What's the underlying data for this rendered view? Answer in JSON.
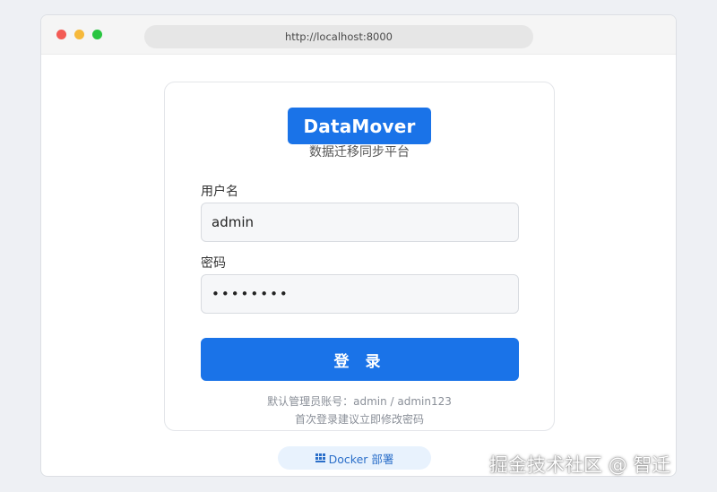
{
  "browser": {
    "url": "http://localhost:8000"
  },
  "login": {
    "brand": "DataMover",
    "subtitle": "数据迁移同步平台",
    "username_label": "用户名",
    "username_value": "admin",
    "password_label": "密码",
    "password_value": "••••••••",
    "submit_label": "登 录",
    "hint_default": "默认管理员账号：admin / admin123",
    "hint_change": "首次登录建议立即修改密码"
  },
  "footer": {
    "docker_label": "Docker 部署"
  },
  "watermark": "掘金技术社区 @ 智迁",
  "colors": {
    "primary": "#1a73e8",
    "pill_bg": "#e8f2fd",
    "page_bg": "#eef0f4"
  },
  "icons": {
    "docker": "docker-icon"
  }
}
